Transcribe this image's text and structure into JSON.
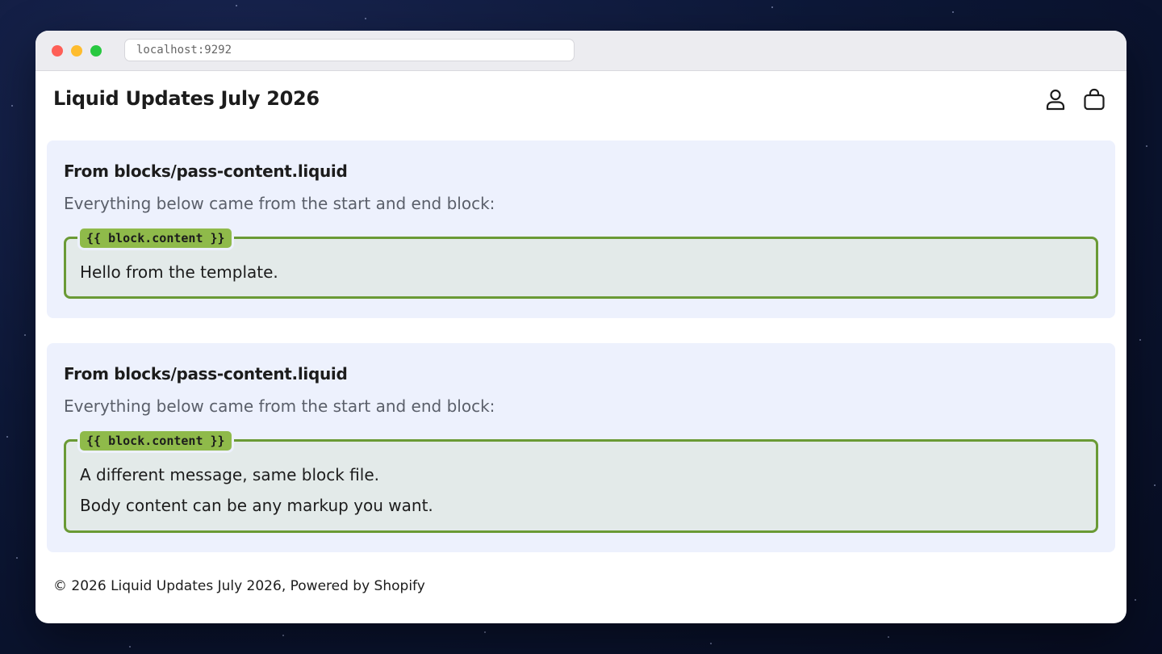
{
  "browser": {
    "url": "localhost:9292"
  },
  "header": {
    "site_title": "Liquid Updates July 2026",
    "icons": [
      "account-icon",
      "cart-icon"
    ]
  },
  "sections": [
    {
      "title": "From blocks/pass-content.liquid",
      "description": "Everything below came from the start and end block:",
      "tag": "{{ block.content }}",
      "lines": [
        "Hello from the template."
      ]
    },
    {
      "title": "From blocks/pass-content.liquid",
      "description": "Everything below came from the start and end block:",
      "tag": "{{ block.content }}",
      "lines": [
        "A different message, same block file.",
        "Body content can be any markup you want."
      ]
    }
  ],
  "footer": {
    "text": "© 2026 Liquid Updates July 2026, Powered by Shopify"
  },
  "colors": {
    "section_bg": "#edf1fd",
    "content_border": "#6a9a35",
    "content_bg": "#e3eae9",
    "tag_bg": "#8fba4a"
  }
}
